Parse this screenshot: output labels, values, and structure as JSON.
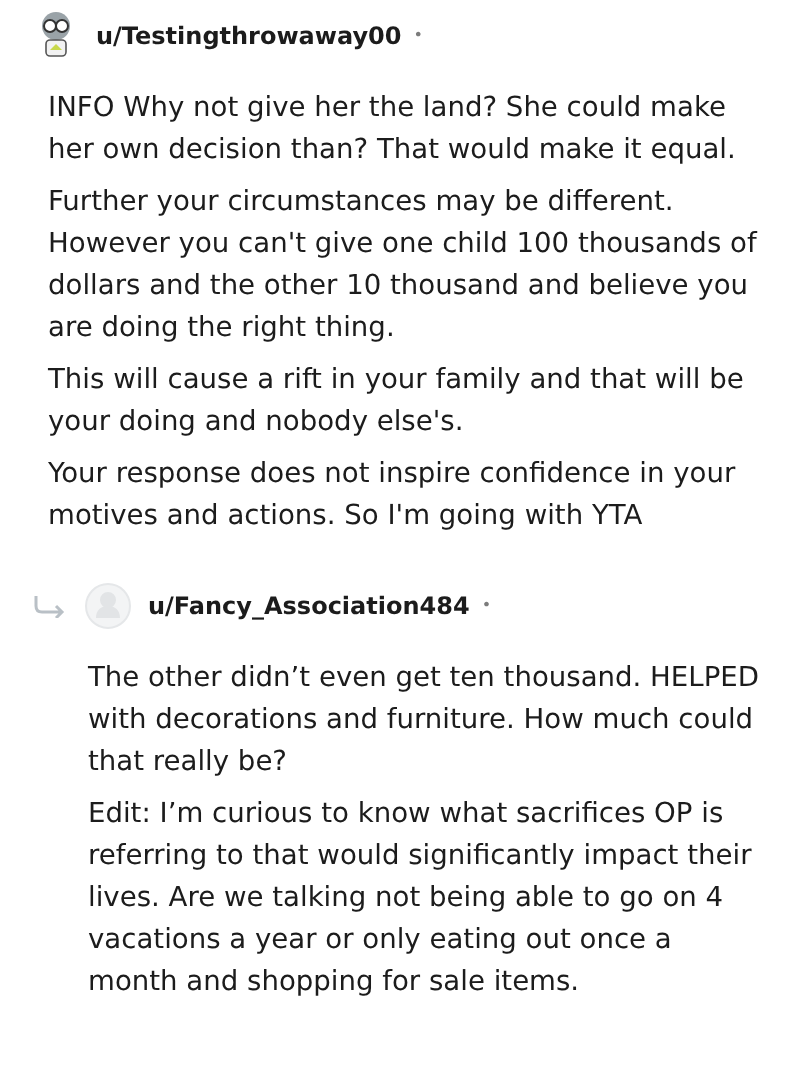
{
  "comments": [
    {
      "author": "u/Testingthrowaway00",
      "separator": "•",
      "reply": false,
      "paragraphs": [
        "INFO Why not give her the land? She could make her own decision than? That would make it equal.",
        "Further your circumstances may be different. However you can't give one child 100 thousands of dollars and the other 10 thousand and believe you are doing the right thing.",
        "This will cause a rift in your family and that will be your doing and nobody else's.",
        "Your response does not inspire confidence in your motives and actions. So I'm going with YTA"
      ]
    },
    {
      "author": "u/Fancy_Association484",
      "separator": "•",
      "reply": true,
      "paragraphs": [
        "The other didn’t even get ten thousand. HELPED with decorations and furniture. How much could that really be?",
        "Edit: I’m curious to know what sacrifices OP is referring to that would significantly impact their lives. Are we talking not being able to go on 4 vacations a year or only eating out once a month and shopping for sale items."
      ]
    }
  ]
}
